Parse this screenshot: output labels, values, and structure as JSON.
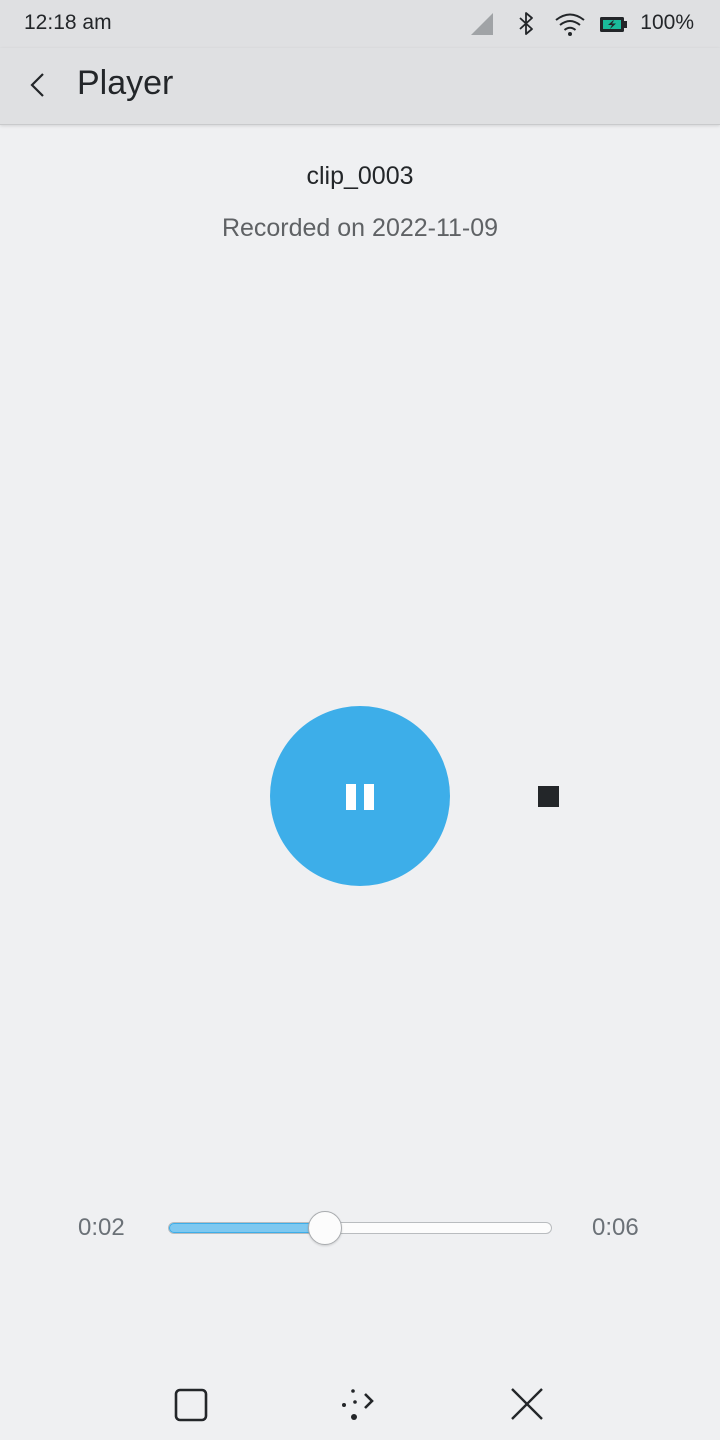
{
  "status_bar": {
    "time": "12:18 am",
    "battery": "100%",
    "icons": [
      "signal-icon",
      "bluetooth-icon",
      "wifi-icon",
      "battery-icon"
    ]
  },
  "header": {
    "title": "Player",
    "back_icon": "chevron-left-icon"
  },
  "recording": {
    "name": "clip_0003",
    "date_line": "Recorded on 2022-11-09"
  },
  "controls": {
    "primary": "pause-icon",
    "secondary": "stop-icon",
    "accent_color": "#3daee9"
  },
  "progress": {
    "current_time": "0:02",
    "total_time": "0:06",
    "fraction": 0.41
  },
  "nav_bar": {
    "icons": [
      "overview-icon",
      "keyboard-toggle-icon",
      "close-icon"
    ]
  }
}
